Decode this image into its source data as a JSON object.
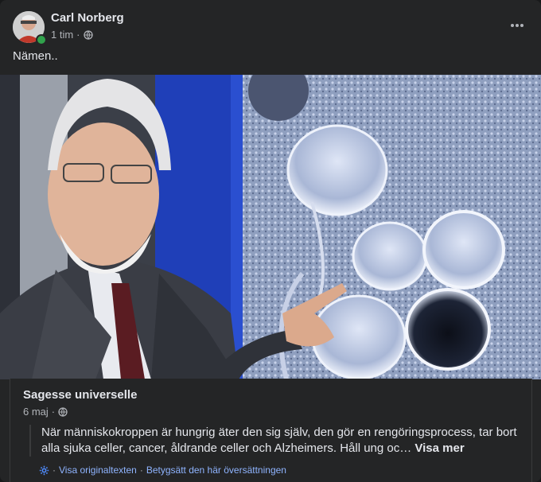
{
  "post": {
    "author": "Carl Norberg",
    "time": "1 tim",
    "separator": "·",
    "text": "Nämen..",
    "more_label": "•••"
  },
  "shared": {
    "source": "Sagesse universelle",
    "date": "6 maj",
    "separator": "·",
    "body": "När människokroppen är hungrig äter den sig själv, den gör en rengöringsprocess, tar bort alla sjuka celler, cancer, åldrande celler och Alzheimers. Håll ung oc…",
    "see_more": "Visa mer",
    "translate": {
      "view_original": "Visa originaltexten",
      "dot": "·",
      "rate": "Betygsätt den här översättningen"
    }
  },
  "colors": {
    "background": "#242526",
    "text": "#e4e6eb",
    "secondary": "#b0b3b8",
    "link": "#8fb4ff",
    "online": "#31a24c"
  }
}
